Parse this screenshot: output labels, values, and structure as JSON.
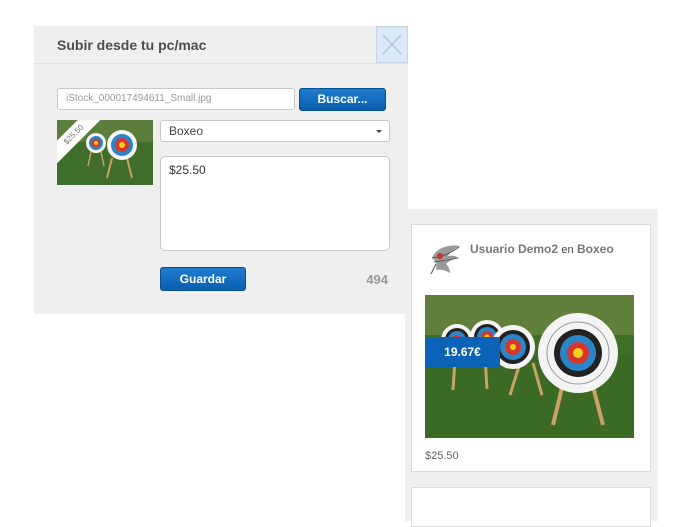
{
  "dialog": {
    "title": "Subir desde tu pc/mac",
    "file_name": "iStock_000017494611_Small.jpg",
    "search_label": "Buscar...",
    "thumb_ribbon": "$25.50",
    "category_selected": "Boxeo",
    "description_value": "$25.50",
    "save_label": "Guardar",
    "char_counter": "494",
    "close_icon": "close-x-icon"
  },
  "card": {
    "user": "Usuario Demo2",
    "en": "en",
    "category": "Boxeo",
    "price_tag": "19.67€",
    "description": "$25.50",
    "avatar_icon": "feather-avatar-icon"
  },
  "colors": {
    "accent_blue": "#0b63b8",
    "dialog_bg": "#efefef",
    "close_bg": "#dbe9f6"
  }
}
